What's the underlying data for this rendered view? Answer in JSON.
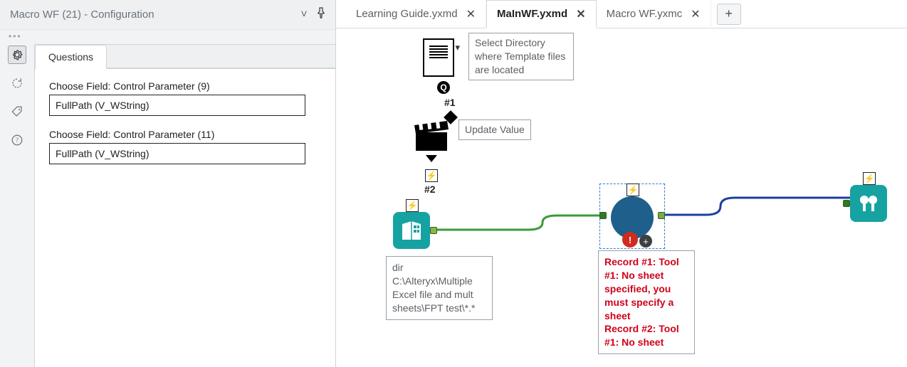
{
  "config_panel": {
    "title": "Macro WF (21) - Configuration",
    "tab_label": "Questions",
    "fields": [
      {
        "label": "Choose Field: Control Parameter (9)",
        "value": "FullPath (V_WString)"
      },
      {
        "label": "Choose Field: Control Parameter (11)",
        "value": "FullPath (V_WString)"
      }
    ]
  },
  "doc_tabs": [
    {
      "name": "Learning Guide.yxmd",
      "active": false
    },
    {
      "name": "MaInWF.yxmd",
      "active": true
    },
    {
      "name": "Macro WF.yxmc",
      "active": false
    }
  ],
  "canvas": {
    "select_dir_label": "Select Directory where Template files are located",
    "update_value_label": "Update Value",
    "hash1": "#1",
    "hash2": "#2",
    "dir_text": "dir C:\\Alteryx\\Multiple Excel file and mult sheets\\FPT test\\*.*",
    "error_text": "Record #1: Tool #1: No sheet specified, you must specify a sheet\nRecord #2: Tool #1: No sheet"
  }
}
